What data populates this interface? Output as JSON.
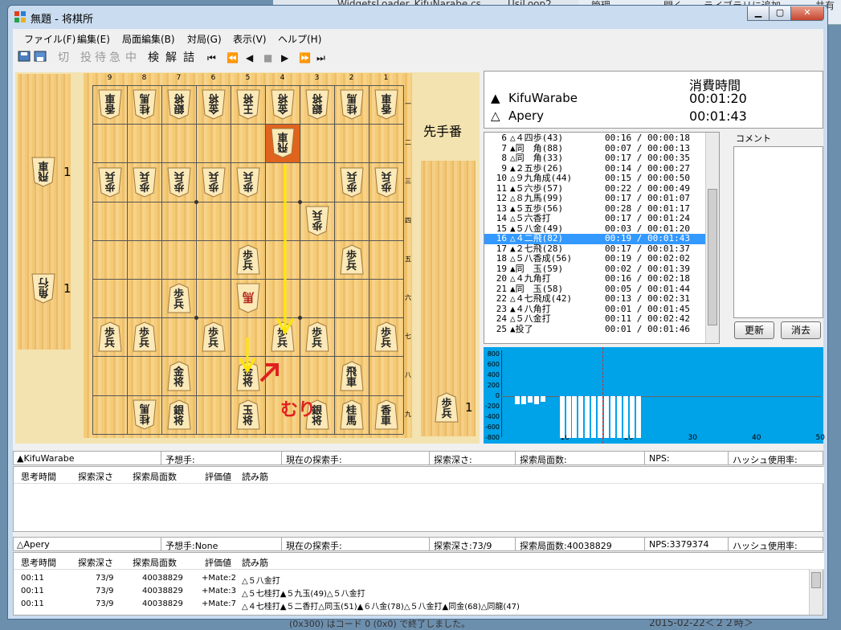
{
  "window": {
    "title": "無題 - 将棋所"
  },
  "background": {
    "tabs": [
      "WidgetsLoader_KifuNarabe.cs",
      "UsiLoop2",
      "管理",
      "開く",
      "ライブラリに追加",
      "共有"
    ],
    "bottom_text": "2015-02-22＜２２時＞",
    "console_text": "(0x300) はコード 0 (0x0) で終了しました。"
  },
  "menu": [
    "ファイル(F)",
    "編集(E)",
    "局面編集(B)",
    "対局(G)",
    "表示(V)",
    "ヘルプ(H)"
  ],
  "toolbar": {
    "edit_tools": [
      "切",
      "投",
      "待",
      "急",
      "中"
    ],
    "tools": [
      "検",
      "解",
      "詰"
    ],
    "nav": [
      "⏮",
      "⏪",
      "◀",
      "■",
      "▶",
      "⏩",
      "⏭"
    ]
  },
  "board": {
    "file_labels": [
      "9",
      "8",
      "7",
      "6",
      "5",
      "4",
      "3",
      "2",
      "1"
    ],
    "rank_labels": [
      "一",
      "二",
      "三",
      "四",
      "五",
      "六",
      "七",
      "八",
      "九"
    ],
    "turn_label": "先手番",
    "gote_hand": [
      {
        "c1": "飛",
        "c2": "車",
        "count": "1"
      },
      {
        "c1": "角",
        "c2": "行",
        "count": "1"
      }
    ],
    "sente_hand": [
      {
        "c1": "歩",
        "c2": "兵",
        "count": "1"
      }
    ],
    "pieces": [
      {
        "f": 9,
        "r": 1,
        "c1": "香",
        "c2": "車",
        "side": "gote"
      },
      {
        "f": 8,
        "r": 1,
        "c1": "桂",
        "c2": "馬",
        "side": "gote"
      },
      {
        "f": 7,
        "r": 1,
        "c1": "銀",
        "c2": "将",
        "side": "gote"
      },
      {
        "f": 6,
        "r": 1,
        "c1": "金",
        "c2": "将",
        "side": "gote"
      },
      {
        "f": 5,
        "r": 1,
        "c1": "王",
        "c2": "将",
        "side": "gote"
      },
      {
        "f": 4,
        "r": 1,
        "c1": "金",
        "c2": "将",
        "side": "gote"
      },
      {
        "f": 3,
        "r": 1,
        "c1": "銀",
        "c2": "将",
        "side": "gote"
      },
      {
        "f": 2,
        "r": 1,
        "c1": "桂",
        "c2": "馬",
        "side": "gote"
      },
      {
        "f": 1,
        "r": 1,
        "c1": "香",
        "c2": "車",
        "side": "gote"
      },
      {
        "f": 4,
        "r": 2,
        "c1": "飛",
        "c2": "車",
        "side": "gote",
        "highlight": true
      },
      {
        "f": 9,
        "r": 3,
        "c1": "歩",
        "c2": "兵",
        "side": "gote"
      },
      {
        "f": 8,
        "r": 3,
        "c1": "歩",
        "c2": "兵",
        "side": "gote"
      },
      {
        "f": 7,
        "r": 3,
        "c1": "歩",
        "c2": "兵",
        "side": "gote"
      },
      {
        "f": 6,
        "r": 3,
        "c1": "歩",
        "c2": "兵",
        "side": "gote"
      },
      {
        "f": 5,
        "r": 3,
        "c1": "歩",
        "c2": "兵",
        "side": "gote"
      },
      {
        "f": 2,
        "r": 3,
        "c1": "歩",
        "c2": "兵",
        "side": "gote"
      },
      {
        "f": 1,
        "r": 3,
        "c1": "歩",
        "c2": "兵",
        "side": "gote"
      },
      {
        "f": 3,
        "r": 4,
        "c1": "歩",
        "c2": "兵",
        "side": "gote"
      },
      {
        "f": 5,
        "r": 5,
        "c1": "歩",
        "c2": "兵",
        "side": "sente"
      },
      {
        "f": 2,
        "r": 5,
        "c1": "歩",
        "c2": "兵",
        "side": "sente"
      },
      {
        "f": 7,
        "r": 6,
        "c1": "歩",
        "c2": "兵",
        "side": "sente"
      },
      {
        "f": 5,
        "r": 6,
        "c1": "馬",
        "c2": "",
        "side": "gote",
        "promoted": true
      },
      {
        "f": 9,
        "r": 7,
        "c1": "歩",
        "c2": "兵",
        "side": "sente"
      },
      {
        "f": 8,
        "r": 7,
        "c1": "歩",
        "c2": "兵",
        "side": "sente"
      },
      {
        "f": 6,
        "r": 7,
        "c1": "歩",
        "c2": "兵",
        "side": "sente"
      },
      {
        "f": 4,
        "r": 7,
        "c1": "歩",
        "c2": "兵",
        "side": "sente"
      },
      {
        "f": 3,
        "r": 7,
        "c1": "歩",
        "c2": "兵",
        "side": "sente"
      },
      {
        "f": 1,
        "r": 7,
        "c1": "歩",
        "c2": "兵",
        "side": "sente"
      },
      {
        "f": 7,
        "r": 8,
        "c1": "金",
        "c2": "将",
        "side": "sente"
      },
      {
        "f": 5,
        "r": 8,
        "c1": "金",
        "c2": "将",
        "side": "sente"
      },
      {
        "f": 2,
        "r": 8,
        "c1": "飛",
        "c2": "車",
        "side": "sente"
      },
      {
        "f": 8,
        "r": 9,
        "c1": "桂",
        "c2": "馬",
        "side": "gote"
      },
      {
        "f": 7,
        "r": 9,
        "c1": "銀",
        "c2": "将",
        "side": "sente"
      },
      {
        "f": 5,
        "r": 9,
        "c1": "玉",
        "c2": "将",
        "side": "sente"
      },
      {
        "f": 3,
        "r": 9,
        "c1": "銀",
        "c2": "将",
        "side": "sente"
      },
      {
        "f": 2,
        "r": 9,
        "c1": "桂",
        "c2": "馬",
        "side": "sente"
      },
      {
        "f": 1,
        "r": 9,
        "c1": "香",
        "c2": "車",
        "side": "sente"
      }
    ],
    "annotation": "むり"
  },
  "players": {
    "time_header": "消費時間",
    "sente": {
      "mark": "▲",
      "name": "KifuWarabe",
      "time": "00:01:20"
    },
    "gote": {
      "mark": "△",
      "name": "Apery",
      "time": "00:01:43"
    }
  },
  "kifu": {
    "rows": [
      {
        "n": "6",
        "move": "△４四歩(43)",
        "t": "00:16 / 00:00:18"
      },
      {
        "n": "7",
        "move": "▲同　角(88)",
        "t": "00:07 / 00:00:13"
      },
      {
        "n": "8",
        "move": "△同　角(33)",
        "t": "00:17 / 00:00:35"
      },
      {
        "n": "9",
        "move": "▲２五歩(26)",
        "t": "00:14 / 00:00:27"
      },
      {
        "n": "10",
        "move": "△９九角成(44)",
        "t": "00:15 / 00:00:50"
      },
      {
        "n": "11",
        "move": "▲５六歩(57)",
        "t": "00:22 / 00:00:49"
      },
      {
        "n": "12",
        "move": "△８九馬(99)",
        "t": "00:17 / 00:01:07"
      },
      {
        "n": "13",
        "move": "▲５五歩(56)",
        "t": "00:28 / 00:01:17"
      },
      {
        "n": "14",
        "move": "△５六香打",
        "t": "00:17 / 00:01:24"
      },
      {
        "n": "15",
        "move": "▲５八金(49)",
        "t": "00:03 / 00:01:20"
      },
      {
        "n": "16",
        "move": "△４二飛(82)",
        "t": "00:19 / 00:01:43"
      },
      {
        "n": "17",
        "move": "▲２七飛(28)",
        "t": "00:17 / 00:01:37"
      },
      {
        "n": "18",
        "move": "△５八香成(56)",
        "t": "00:19 / 00:02:02"
      },
      {
        "n": "19",
        "move": "▲同　玉(59)",
        "t": "00:02 / 00:01:39"
      },
      {
        "n": "20",
        "move": "△４九角打",
        "t": "00:16 / 00:02:18"
      },
      {
        "n": "21",
        "move": "▲同　玉(58)",
        "t": "00:05 / 00:01:44"
      },
      {
        "n": "22",
        "move": "△４七飛成(42)",
        "t": "00:13 / 00:02:31"
      },
      {
        "n": "23",
        "move": "▲４八角打",
        "t": "00:01 / 00:01:45"
      },
      {
        "n": "24",
        "move": "△５八金打",
        "t": "00:11 / 00:02:42"
      },
      {
        "n": "25",
        "move": "▲投了",
        "t": "00:01 / 00:01:46"
      }
    ],
    "selected_move": "16"
  },
  "comment": {
    "label": "コメント",
    "update_button": "更新",
    "clear_button": "消去"
  },
  "eval_graph": {
    "y_ticks": [
      "800",
      "600",
      "400",
      "200",
      "0",
      "-200",
      "-400",
      "-600",
      "-800"
    ],
    "x_ticks": [
      "10",
      "20",
      "30",
      "40",
      "50"
    ],
    "values": [
      0,
      -150,
      -150,
      -120,
      -150,
      -100,
      0,
      0,
      -800,
      -800,
      -800,
      -800,
      -800,
      -800,
      -800,
      -800,
      -800,
      -800,
      -800,
      -800,
      -800
    ]
  },
  "engine1": {
    "name": "▲KifuWarabe",
    "predicted": "予想手:",
    "current": "現在の探索手:",
    "depth": "探索深さ:",
    "nodes": "探索局面数:",
    "nps": "NPS:",
    "hash": "ハッシュ使用率:",
    "cols": [
      "思考時間",
      "探索深さ",
      "探索局面数",
      "評価値",
      "読み筋"
    ]
  },
  "engine2": {
    "name": "△Apery",
    "predicted": "予想手:None",
    "current": "現在の探索手:",
    "depth": "探索深さ:73/9",
    "nodes": "探索局面数:40038829",
    "nps": "NPS:3379374",
    "hash": "ハッシュ使用率:",
    "cols": [
      "思考時間",
      "探索深さ",
      "探索局面数",
      "評価値",
      "読み筋"
    ],
    "rows": [
      {
        "time": "00:11",
        "depth": "73/9",
        "nodes": "40038829",
        "eval": "+Mate:2",
        "pv": "△５八金打"
      },
      {
        "time": "00:11",
        "depth": "73/9",
        "nodes": "40038829",
        "eval": "+Mate:3",
        "pv": "△５七桂打▲５九玉(49)△５八金打"
      },
      {
        "time": "00:11",
        "depth": "73/9",
        "nodes": "40038829",
        "eval": "+Mate:7",
        "pv": "△４七桂打▲５二香打△同玉(51)▲６八金(78)△５八金打▲同金(68)△同龍(47)"
      }
    ]
  }
}
